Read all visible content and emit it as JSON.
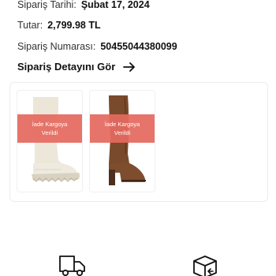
{
  "order": {
    "date_label": "Sipariş Tarihi:",
    "date_value": "Şubat 17, 2024",
    "total_label": "Tutar:",
    "total_value": "2,799.98 TL",
    "number_label": "Sipariş Numarası:",
    "number_value": "50455044380099",
    "detail_link": "Sipariş Detayını Gör"
  },
  "products": [
    {
      "name": "cream-chelsea-boot",
      "status_line1": "İade Kargoya",
      "status_line2": "Verildi"
    },
    {
      "name": "brown-knee-high-boot",
      "status_line1": "İade Kargoya",
      "status_line2": "Verildi"
    }
  ],
  "icons": {
    "arrow": "arrow-right-icon",
    "truck": "truck-icon",
    "box": "box-return-icon"
  },
  "colors": {
    "badge": "#e5695f",
    "text": "#111111",
    "border": "#ececec"
  }
}
